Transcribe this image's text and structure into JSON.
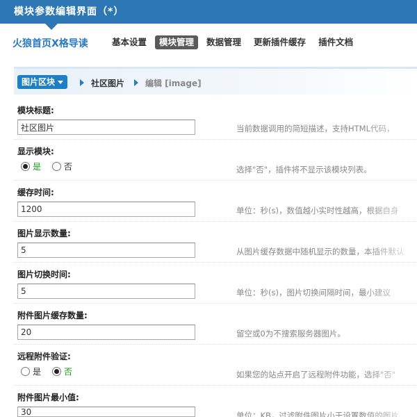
{
  "window": {
    "title": "模块参数编辑界面（*）"
  },
  "brand": "火狼首页X格导读",
  "nav": [
    {
      "label": "基本设置",
      "active": false
    },
    {
      "label": "模块管理",
      "active": true
    },
    {
      "label": "数据管理",
      "active": false
    },
    {
      "label": "更新插件缓存",
      "active": false
    },
    {
      "label": "插件文档",
      "active": false
    }
  ],
  "breadcrumb": {
    "dropdown_label": "图片区块",
    "link": "社区图片",
    "current": "编辑 [image]"
  },
  "fields": {
    "module_title": {
      "label": "模块标题:",
      "value": "社区图片",
      "desc": "当前数据调用的简短描述，支持HTML代码，"
    },
    "show_module": {
      "label": "显示模块:",
      "yes": "是",
      "no": "否",
      "selected": "yes",
      "desc": "选择\"否\"，插件将不显示该模块列表。"
    },
    "cache_time": {
      "label": "缓存时间:",
      "value": "1200",
      "desc": "单位：秒(s)，数值越小实时性越高，根据自身"
    },
    "image_count": {
      "label": "图片显示数量:",
      "value": "5",
      "desc": "从图片缓存数据中随机显示的数量，本插件默认"
    },
    "switch_time": {
      "label": "图片切换时间:",
      "value": "5",
      "desc": "单位：秒(s)，图片切换间隔时间，最小建议"
    },
    "attach_cache_count": {
      "label": "附件图片缓存数量:",
      "value": "20",
      "desc": "留空或0为不搜索服务器图片。"
    },
    "remote_verify": {
      "label": "远程附件验证:",
      "yes": "是",
      "no": "否",
      "selected": "no",
      "desc": "如果您的站点开启了远程附件功能，选择\"否\""
    },
    "min_size": {
      "label": "附件图片最小值:",
      "value": "30",
      "desc": "单位：KB，过滤附件图片小于设置数值的图片"
    }
  }
}
